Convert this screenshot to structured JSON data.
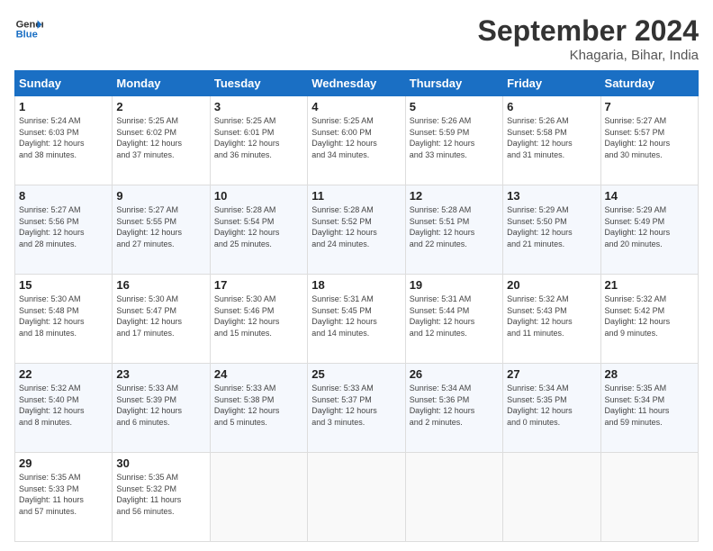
{
  "logo": {
    "text_general": "General",
    "text_blue": "Blue"
  },
  "title": "September 2024",
  "subtitle": "Khagaria, Bihar, India",
  "days_of_week": [
    "Sunday",
    "Monday",
    "Tuesday",
    "Wednesday",
    "Thursday",
    "Friday",
    "Saturday"
  ],
  "weeks": [
    [
      {
        "day": "1",
        "info": "Sunrise: 5:24 AM\nSunset: 6:03 PM\nDaylight: 12 hours\nand 38 minutes."
      },
      {
        "day": "2",
        "info": "Sunrise: 5:25 AM\nSunset: 6:02 PM\nDaylight: 12 hours\nand 37 minutes."
      },
      {
        "day": "3",
        "info": "Sunrise: 5:25 AM\nSunset: 6:01 PM\nDaylight: 12 hours\nand 36 minutes."
      },
      {
        "day": "4",
        "info": "Sunrise: 5:25 AM\nSunset: 6:00 PM\nDaylight: 12 hours\nand 34 minutes."
      },
      {
        "day": "5",
        "info": "Sunrise: 5:26 AM\nSunset: 5:59 PM\nDaylight: 12 hours\nand 33 minutes."
      },
      {
        "day": "6",
        "info": "Sunrise: 5:26 AM\nSunset: 5:58 PM\nDaylight: 12 hours\nand 31 minutes."
      },
      {
        "day": "7",
        "info": "Sunrise: 5:27 AM\nSunset: 5:57 PM\nDaylight: 12 hours\nand 30 minutes."
      }
    ],
    [
      {
        "day": "8",
        "info": "Sunrise: 5:27 AM\nSunset: 5:56 PM\nDaylight: 12 hours\nand 28 minutes."
      },
      {
        "day": "9",
        "info": "Sunrise: 5:27 AM\nSunset: 5:55 PM\nDaylight: 12 hours\nand 27 minutes."
      },
      {
        "day": "10",
        "info": "Sunrise: 5:28 AM\nSunset: 5:54 PM\nDaylight: 12 hours\nand 25 minutes."
      },
      {
        "day": "11",
        "info": "Sunrise: 5:28 AM\nSunset: 5:52 PM\nDaylight: 12 hours\nand 24 minutes."
      },
      {
        "day": "12",
        "info": "Sunrise: 5:28 AM\nSunset: 5:51 PM\nDaylight: 12 hours\nand 22 minutes."
      },
      {
        "day": "13",
        "info": "Sunrise: 5:29 AM\nSunset: 5:50 PM\nDaylight: 12 hours\nand 21 minutes."
      },
      {
        "day": "14",
        "info": "Sunrise: 5:29 AM\nSunset: 5:49 PM\nDaylight: 12 hours\nand 20 minutes."
      }
    ],
    [
      {
        "day": "15",
        "info": "Sunrise: 5:30 AM\nSunset: 5:48 PM\nDaylight: 12 hours\nand 18 minutes."
      },
      {
        "day": "16",
        "info": "Sunrise: 5:30 AM\nSunset: 5:47 PM\nDaylight: 12 hours\nand 17 minutes."
      },
      {
        "day": "17",
        "info": "Sunrise: 5:30 AM\nSunset: 5:46 PM\nDaylight: 12 hours\nand 15 minutes."
      },
      {
        "day": "18",
        "info": "Sunrise: 5:31 AM\nSunset: 5:45 PM\nDaylight: 12 hours\nand 14 minutes."
      },
      {
        "day": "19",
        "info": "Sunrise: 5:31 AM\nSunset: 5:44 PM\nDaylight: 12 hours\nand 12 minutes."
      },
      {
        "day": "20",
        "info": "Sunrise: 5:32 AM\nSunset: 5:43 PM\nDaylight: 12 hours\nand 11 minutes."
      },
      {
        "day": "21",
        "info": "Sunrise: 5:32 AM\nSunset: 5:42 PM\nDaylight: 12 hours\nand 9 minutes."
      }
    ],
    [
      {
        "day": "22",
        "info": "Sunrise: 5:32 AM\nSunset: 5:40 PM\nDaylight: 12 hours\nand 8 minutes."
      },
      {
        "day": "23",
        "info": "Sunrise: 5:33 AM\nSunset: 5:39 PM\nDaylight: 12 hours\nand 6 minutes."
      },
      {
        "day": "24",
        "info": "Sunrise: 5:33 AM\nSunset: 5:38 PM\nDaylight: 12 hours\nand 5 minutes."
      },
      {
        "day": "25",
        "info": "Sunrise: 5:33 AM\nSunset: 5:37 PM\nDaylight: 12 hours\nand 3 minutes."
      },
      {
        "day": "26",
        "info": "Sunrise: 5:34 AM\nSunset: 5:36 PM\nDaylight: 12 hours\nand 2 minutes."
      },
      {
        "day": "27",
        "info": "Sunrise: 5:34 AM\nSunset: 5:35 PM\nDaylight: 12 hours\nand 0 minutes."
      },
      {
        "day": "28",
        "info": "Sunrise: 5:35 AM\nSunset: 5:34 PM\nDaylight: 11 hours\nand 59 minutes."
      }
    ],
    [
      {
        "day": "29",
        "info": "Sunrise: 5:35 AM\nSunset: 5:33 PM\nDaylight: 11 hours\nand 57 minutes."
      },
      {
        "day": "30",
        "info": "Sunrise: 5:35 AM\nSunset: 5:32 PM\nDaylight: 11 hours\nand 56 minutes."
      },
      {
        "day": "",
        "info": ""
      },
      {
        "day": "",
        "info": ""
      },
      {
        "day": "",
        "info": ""
      },
      {
        "day": "",
        "info": ""
      },
      {
        "day": "",
        "info": ""
      }
    ]
  ]
}
